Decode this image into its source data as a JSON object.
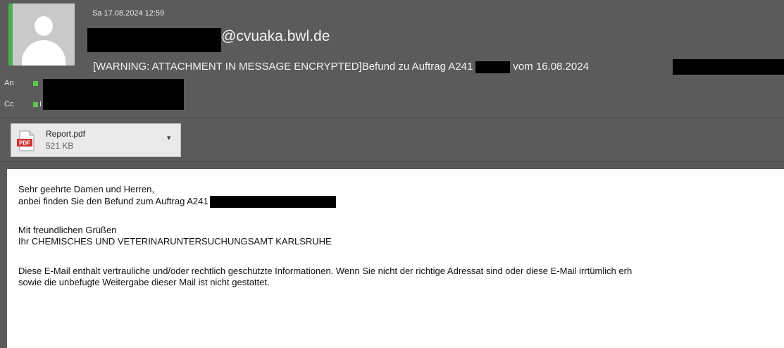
{
  "message": {
    "date": "Sa 17.08.2024 12:59",
    "from_domain": "@cvuaka.bwl.de",
    "subject_prefix": "[WARNING: ATTACHMENT IN MESSAGE ENCRYPTED]Befund zu Auftrag A241",
    "subject_suffix": "vom 16.08.2024",
    "to_label": "An",
    "cc_label": "Cc",
    "cc_initial": "I"
  },
  "attachment": {
    "icon": "pdf-icon",
    "icon_text": "PDF",
    "name": "Report.pdf",
    "size": "521 KB",
    "menu_glyph": "▾"
  },
  "body": {
    "greeting": "Sehr geehrte Damen und Herren,",
    "line2": "anbei finden Sie den Befund zum Auftrag   A241",
    "closing": "Mit freundlichen Grüßen",
    "signature": "Ihr CHEMISCHES UND VETERINARUNTERSUCHUNGSAMT KARLSRUHE",
    "disclaimer_1": "Diese E-Mail enthält vertrauliche und/oder rechtlich geschützte Informationen. Wenn Sie nicht der richtige Adressat sind oder diese E-Mail irrtümlich erh",
    "disclaimer_2": "sowie die unbefugte Weitergabe dieser Mail ist nicht gestattet."
  },
  "colors": {
    "header_bg": "#5b5b5b",
    "presence_green": "#4caf50",
    "redaction": "#000000"
  }
}
